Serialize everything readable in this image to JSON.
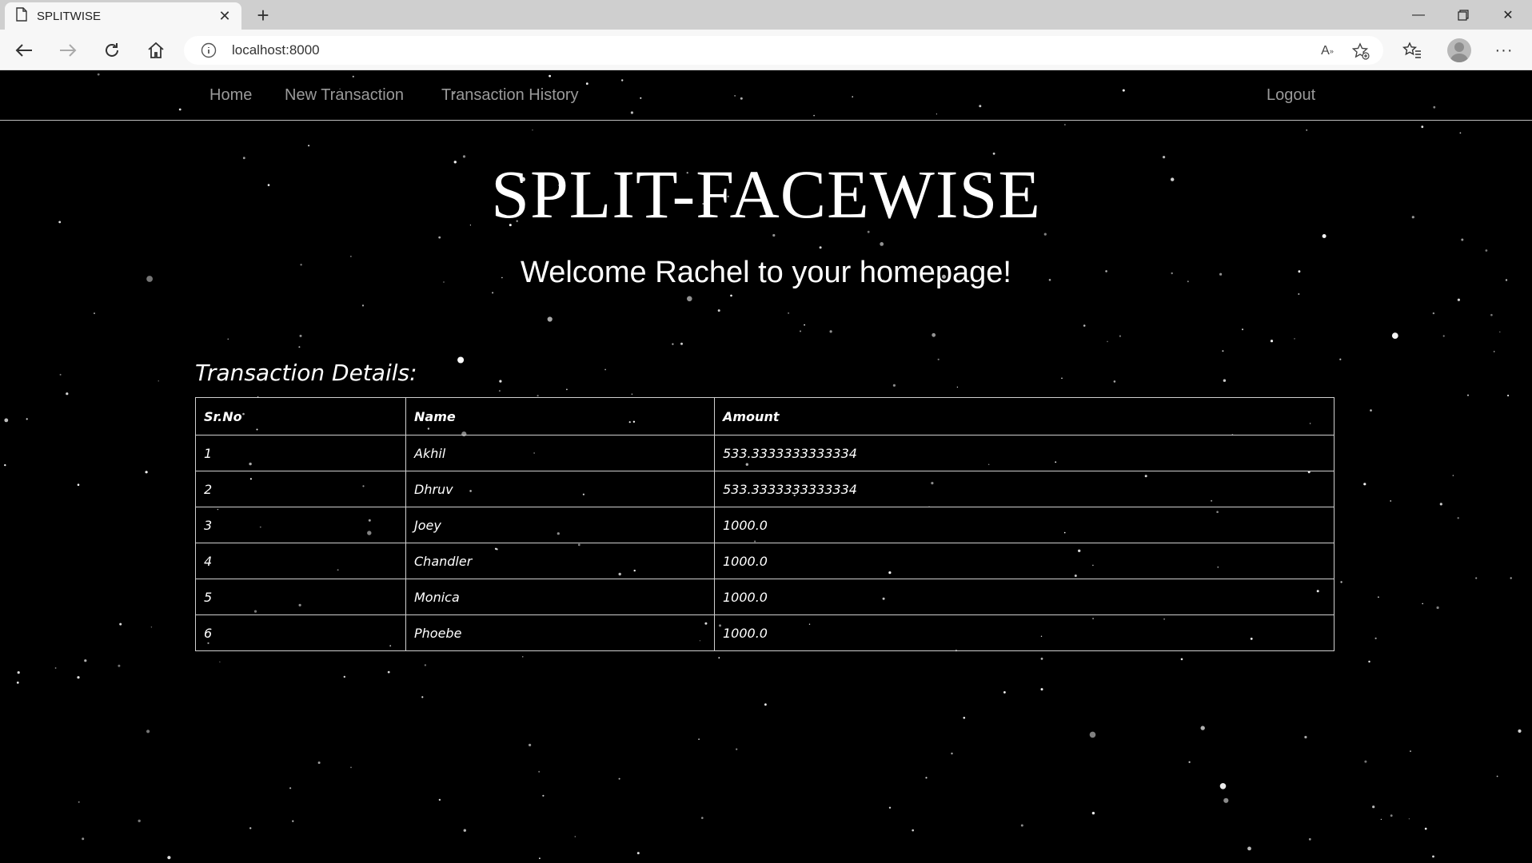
{
  "browser": {
    "tab_title": "SPLITWISE",
    "url": "localhost:8000"
  },
  "nav": {
    "home": "Home",
    "new_transaction": "New Transaction",
    "transaction_history": "Transaction History",
    "logout": "Logout"
  },
  "header": {
    "brand": "SPLIT-FACEWISE",
    "welcome": "Welcome Rachel to your homepage!"
  },
  "transactions": {
    "title": "Transaction Details:",
    "columns": [
      "Sr.No",
      "Name",
      "Amount"
    ],
    "rows": [
      [
        "1",
        "Akhil",
        "533.3333333333334"
      ],
      [
        "2",
        "Dhruv",
        "533.3333333333334"
      ],
      [
        "3",
        "Joey",
        "1000.0"
      ],
      [
        "4",
        "Chandler",
        "1000.0"
      ],
      [
        "5",
        "Monica",
        "1000.0"
      ],
      [
        "6",
        "Phoebe",
        "1000.0"
      ]
    ]
  },
  "colors": {
    "page_background": "#000000",
    "nav_link": "#9a9a9a",
    "text": "#ffffff"
  }
}
